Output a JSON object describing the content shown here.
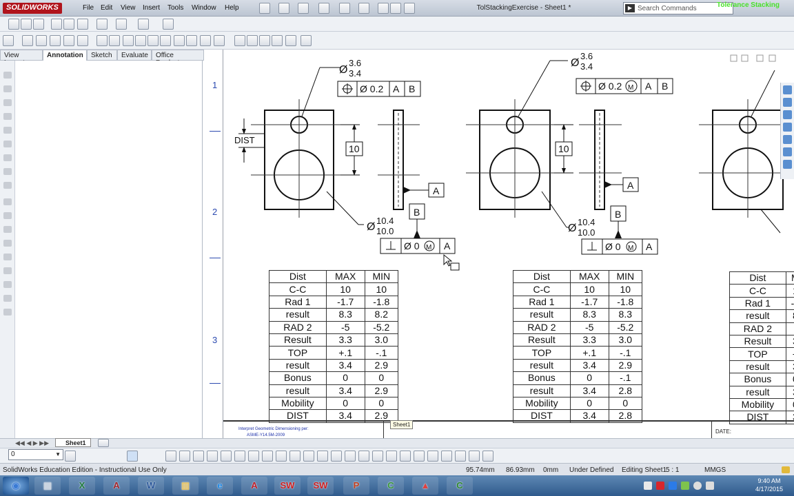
{
  "app": {
    "logo": "SOLIDWORKS",
    "document_title": "TolStackingExercise - Sheet1 *",
    "search_placeholder": "Search Commands",
    "overlay_text": "Tolerance Stacking"
  },
  "menu": [
    "File",
    "Edit",
    "View",
    "Insert",
    "Tools",
    "Window",
    "Help"
  ],
  "tabs": [
    "View Layout",
    "Annotation",
    "Sketch",
    "Evaluate",
    "Office Products"
  ],
  "active_tab": "Annotation",
  "zones": [
    "1",
    "2",
    "3"
  ],
  "views": [
    {
      "small_hole_upper": "3.6",
      "small_hole_lower": "3.4",
      "fcf_top": {
        "tol": "Ø 0.2",
        "modifier": "",
        "datums": [
          "A",
          "B"
        ]
      },
      "dist_label": "DIST",
      "dim_cc": "10",
      "datum_a": "A",
      "datum_b": "B",
      "large_hole_upper": "10.4",
      "large_hole_lower": "10.0",
      "fcf_bottom": {
        "tol": "Ø 0",
        "modifier": "M",
        "datums": [
          "A"
        ]
      }
    },
    {
      "small_hole_upper": "3.6",
      "small_hole_lower": "3.4",
      "fcf_top": {
        "tol": "Ø 0.2",
        "modifier": "M",
        "datums": [
          "A",
          "B"
        ]
      },
      "dist_label": "",
      "dim_cc": "10",
      "datum_a": "A",
      "datum_b": "B",
      "large_hole_upper": "10.4",
      "large_hole_lower": "10.0",
      "fcf_bottom": {
        "tol": "Ø 0",
        "modifier": "M",
        "datums": [
          "A"
        ]
      }
    },
    {
      "small_hole_upper": "",
      "small_hole_lower": "",
      "fcf_top": null,
      "dist_label": "",
      "dim_cc": "",
      "datum_a": "",
      "datum_b": "",
      "large_hole_upper": "",
      "large_hole_lower": "",
      "fcf_bottom": null
    }
  ],
  "tables": [
    {
      "header": [
        "Dist",
        "MAX",
        "MIN"
      ],
      "rows": [
        [
          "C-C",
          "10",
          "10"
        ],
        [
          "Rad 1",
          "-1.7",
          "-1.8"
        ],
        [
          "result",
          "8.3",
          "8.2"
        ],
        [
          "RAD 2",
          "-5",
          "-5.2"
        ],
        [
          "Result",
          "3.3",
          "3.0"
        ],
        [
          "TOP",
          "+.1",
          "-.1"
        ],
        [
          "result",
          "3.4",
          "2.9"
        ],
        [
          "Bonus",
          "0",
          "0"
        ],
        [
          "result",
          "3.4",
          "2.9"
        ],
        [
          "Mobility",
          "0",
          "0"
        ],
        [
          "DIST",
          "3.4",
          "2.9"
        ]
      ]
    },
    {
      "header": [
        "Dist",
        "MAX",
        "MIN"
      ],
      "rows": [
        [
          "C-C",
          "10",
          "10"
        ],
        [
          "Rad 1",
          "-1.7",
          "-1.8"
        ],
        [
          "result",
          "8.3",
          "8.3"
        ],
        [
          "RAD 2",
          "-5",
          "-5.2"
        ],
        [
          "Result",
          "3.3",
          "3.0"
        ],
        [
          "TOP",
          "+.1",
          "-.1"
        ],
        [
          "result",
          "3.4",
          "2.9"
        ],
        [
          "Bonus",
          "0",
          "-.1"
        ],
        [
          "result",
          "3.4",
          "2.8"
        ],
        [
          "Mobility",
          "0",
          "0"
        ],
        [
          "DIST",
          "3.4",
          "2.8"
        ]
      ]
    },
    {
      "header": [
        "Dist",
        "M"
      ],
      "rows": [
        [
          "C-C",
          "1"
        ],
        [
          "Rad 1",
          "-1"
        ],
        [
          "result",
          "8"
        ],
        [
          "RAD 2",
          "-"
        ],
        [
          "Result",
          "3"
        ],
        [
          "TOP",
          "+"
        ],
        [
          "result",
          "3"
        ],
        [
          "Bonus",
          "0"
        ],
        [
          "result",
          "3"
        ],
        [
          "Mobility",
          "0"
        ],
        [
          "DIST",
          "3"
        ]
      ]
    }
  ],
  "titleblock": {
    "note_line1": "Interpret Geometric Dimensioning per:",
    "note_line2": "ASME-Y14.5M-2009",
    "date_label": "DATE:"
  },
  "tooltip": "Sheet1",
  "sheet_tab": "Sheet1",
  "layer_value": "0",
  "status": {
    "edition": "SolidWorks Education Edition - Instructional Use Only",
    "x": "95.74mm",
    "y": "86.93mm",
    "z": "0mm",
    "state": "Under Defined",
    "editing": "Editing Sheet1",
    "scale": "5 : 1",
    "units": "MMGS"
  },
  "clock": {
    "time": "9:40 AM",
    "date": "4/17/2015"
  },
  "taskbar": [
    {
      "name": "start",
      "glyph": "◉",
      "color": "#3a7bd5"
    },
    {
      "name": "explorer",
      "glyph": "▤",
      "color": "#c9d3df"
    },
    {
      "name": "excel",
      "glyph": "X",
      "color": "#1f7a3d"
    },
    {
      "name": "access",
      "glyph": "A",
      "color": "#a4262c"
    },
    {
      "name": "word",
      "glyph": "W",
      "color": "#2b579a"
    },
    {
      "name": "folder",
      "glyph": "▥",
      "color": "#e8c25a"
    },
    {
      "name": "ie",
      "glyph": "e",
      "color": "#1e88e5"
    },
    {
      "name": "acrobat",
      "glyph": "A",
      "color": "#c0202a"
    },
    {
      "name": "solidworks1",
      "glyph": "SW",
      "color": "#d02020"
    },
    {
      "name": "solidworks2",
      "glyph": "SW",
      "color": "#d02020"
    },
    {
      "name": "powerpoint",
      "glyph": "P",
      "color": "#c43e1c"
    },
    {
      "name": "camtasia",
      "glyph": "C",
      "color": "#3a9a3a"
    },
    {
      "name": "pdf",
      "glyph": "▲",
      "color": "#e04040"
    },
    {
      "name": "camtasia2",
      "glyph": "C",
      "color": "#2f8a2f"
    }
  ]
}
